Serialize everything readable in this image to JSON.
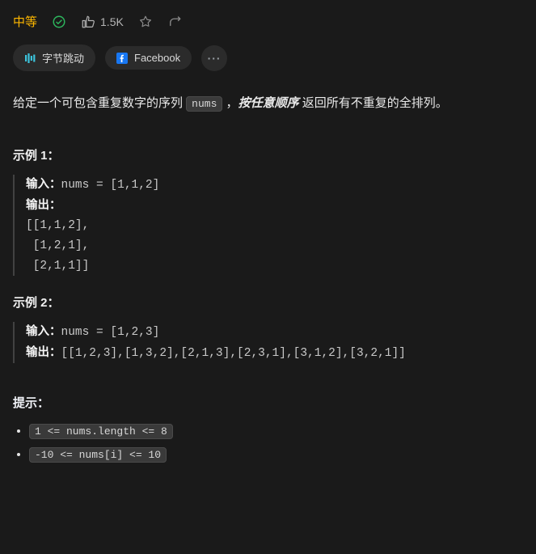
{
  "header": {
    "difficulty": "中等",
    "likes": "1.5K"
  },
  "tags": {
    "bytedance": "字节跳动",
    "facebook": "Facebook"
  },
  "desc": {
    "p1": "给定一个可包含重复数字的序列 ",
    "var": "nums",
    "p2": " ，",
    "emph": "按任意顺序",
    "p3": " 返回所有不重复的全排列。"
  },
  "ex1": {
    "title": "示例 1：",
    "in_label": "输入：",
    "in_val": "nums = [1,1,2]",
    "out_label": "输出：",
    "out_val": "[[1,1,2],\n [1,2,1],\n [2,1,1]]"
  },
  "ex2": {
    "title": "示例 2：",
    "in_label": "输入：",
    "in_val": "nums = [1,2,3]",
    "out_label": "输出：",
    "out_val": "[[1,2,3],[1,3,2],[2,1,3],[2,3,1],[3,1,2],[3,2,1]]"
  },
  "hints": {
    "title": "提示：",
    "c1": "1 <= nums.length <= 8",
    "c2": "-10 <= nums[i] <= 10"
  }
}
